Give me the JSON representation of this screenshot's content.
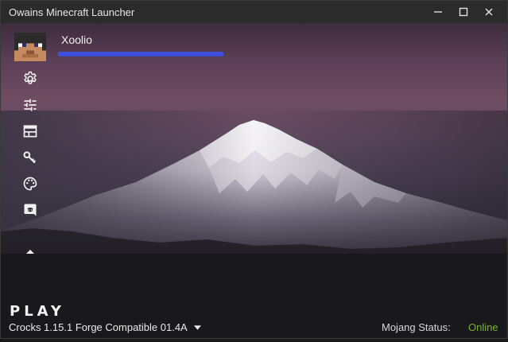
{
  "window": {
    "title": "Owains Minecraft Launcher",
    "minimize_icon": "minimize-icon",
    "maximize_icon": "maximize-icon",
    "close_icon": "close-icon"
  },
  "profile": {
    "username": "Xoolio",
    "email_redacted": true,
    "redaction_color": "#3d4fdc",
    "avatar_icon": "player-skin-avatar"
  },
  "sidebar": {
    "items": [
      {
        "icon": "settings-gear-icon"
      },
      {
        "icon": "tune-sliders-icon"
      },
      {
        "icon": "browser-window-icon"
      },
      {
        "icon": "key-icon"
      },
      {
        "icon": "palette-icon"
      },
      {
        "icon": "discord-icon"
      }
    ],
    "collapse_icon": "caret-up-icon"
  },
  "footer": {
    "play_label": "PLAY",
    "version_label": "Crocks 1.15.1 Forge Compatible 01.4A",
    "version_dropdown_icon": "caret-down-icon",
    "status_label": "Mojang Status:",
    "status_value": "Online",
    "status_color": "#7ab52a"
  },
  "background": {
    "image": "snow-capped-mountain-at-dusk"
  }
}
